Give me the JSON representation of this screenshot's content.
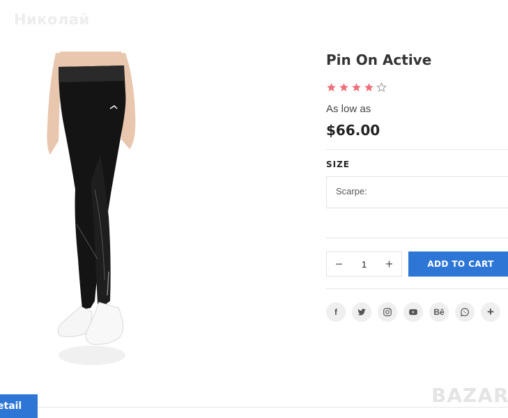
{
  "watermark": {
    "text": "Николай"
  },
  "product": {
    "title": "Pin On Active",
    "rating": {
      "value": 4,
      "max": 5
    },
    "price_label": "As low as",
    "price": "$66.00"
  },
  "size": {
    "label": "SIZE",
    "selected": "Scarpe:"
  },
  "quantity": {
    "minus": "−",
    "value": "1",
    "plus": "+"
  },
  "add_to_cart": {
    "label": "ADD TO CART"
  },
  "social": [
    {
      "icon": "facebook-icon",
      "glyph": "f"
    },
    {
      "icon": "twitter-icon",
      "glyph": ""
    },
    {
      "icon": "instagram-icon",
      "glyph": ""
    },
    {
      "icon": "youtube-icon",
      "glyph": ""
    },
    {
      "icon": "behance-icon",
      "glyph": "Bē"
    },
    {
      "icon": "whatsapp-icon",
      "glyph": ""
    },
    {
      "icon": "plus-icon",
      "glyph": "+"
    }
  ],
  "tabs": {
    "detail": "etail"
  },
  "brand_logo": {
    "text": "BAZAR"
  },
  "colors": {
    "accent": "#2e76d6",
    "star": "#f06e7a",
    "star_empty": "#bbbbbb",
    "social_bg": "#efefef"
  }
}
